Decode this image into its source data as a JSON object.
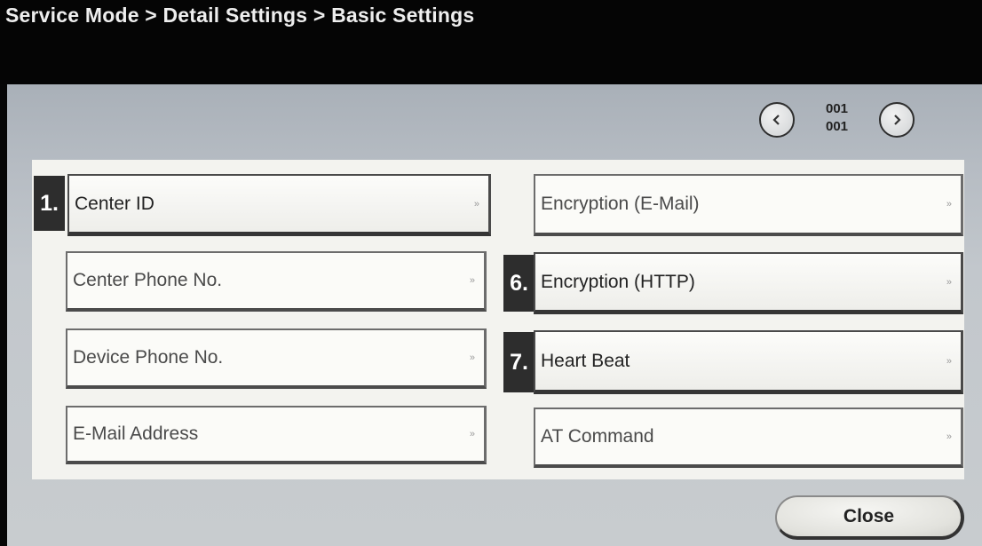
{
  "header": {
    "breadcrumb": "Service Mode > Detail Settings > Basic Settings"
  },
  "pager": {
    "prev_icon": "chevron-left-icon",
    "next_icon": "chevron-right-icon",
    "current_page": "001",
    "total_pages": "001"
  },
  "left_items": [
    {
      "label": "Center ID",
      "number": "1.",
      "state": "active"
    },
    {
      "label": "Center Phone No.",
      "number": "",
      "state": "disabled"
    },
    {
      "label": "Device Phone No.",
      "number": "",
      "state": "disabled"
    },
    {
      "label": "E-Mail Address",
      "number": "",
      "state": "disabled"
    }
  ],
  "right_items": [
    {
      "label": "Encryption (E-Mail)",
      "number": "",
      "state": "disabled"
    },
    {
      "label": "Encryption (HTTP)",
      "number": "6.",
      "state": "active"
    },
    {
      "label": "Heart Beat",
      "number": "7.",
      "state": "active"
    },
    {
      "label": "AT Command",
      "number": "",
      "state": "disabled"
    }
  ],
  "item_arrow": "»",
  "footer": {
    "close_label": "Close"
  },
  "colors": {
    "title_bar": "#050505",
    "panel": "#c2c7cc",
    "list_background": "#f3f3ef",
    "number_badge": "#2d2d2d"
  }
}
